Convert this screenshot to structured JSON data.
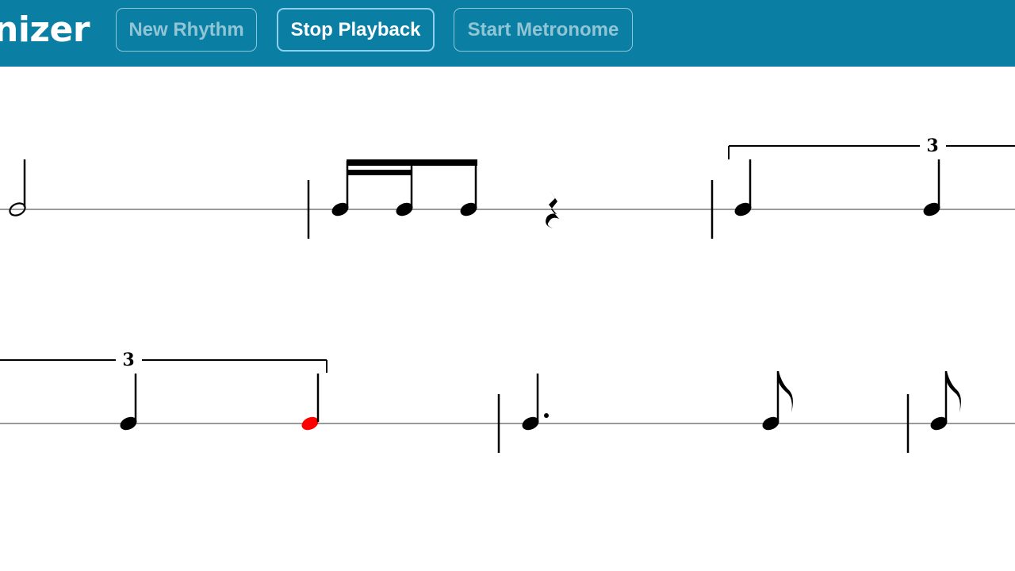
{
  "header": {
    "app_title": "nizer",
    "buttons": [
      {
        "label": "New Rhythm",
        "state": "disabled"
      },
      {
        "label": "Stop Playback",
        "state": "active"
      },
      {
        "label": "Start Metronome",
        "state": "disabled"
      }
    ]
  },
  "score": {
    "tuplet_number_top": "3",
    "tuplet_number_bottom": "3",
    "highlighted_note": "bottom staff, third note (quarter note, triplet end)",
    "colors": {
      "header_bg": "#0a7fa3",
      "staff_line": "#999999",
      "note": "#000000",
      "highlight": "#ff0000"
    }
  }
}
